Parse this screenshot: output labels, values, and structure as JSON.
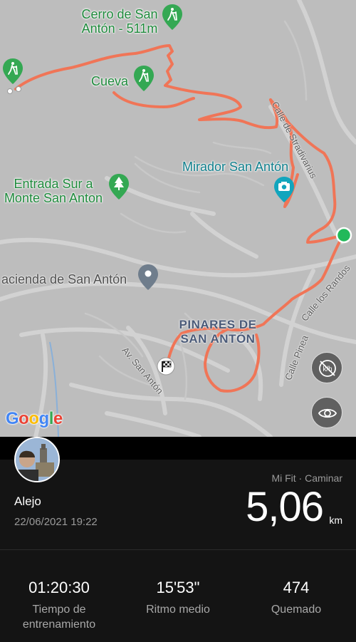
{
  "map": {
    "places": {
      "cerro": "Cerro de San\nAntón - 511m",
      "cueva": "Cueva",
      "mirador": "Mirador San Antón",
      "entrada": "Entrada Sur a\nMonte San Anton",
      "hacienda": "acienda de San Antón",
      "pinares": "PINARES DE\nSAN ANTÓN"
    },
    "streets": {
      "stradivarius": "Calle de Stradivarius",
      "randos": "Calle los Randos",
      "pinea": "Calle Pinea",
      "av_san_anton": "Av. San Antón"
    },
    "attribution": "Google",
    "route_color": "#f07557",
    "buttons": {
      "layers_icon": "km-layer-off-icon",
      "view_icon": "eye-icon"
    }
  },
  "activity": {
    "user_name": "Alejo",
    "datetime": "22/06/2021 19:22",
    "source": "Mi Fit · Caminar",
    "distance": "5,06",
    "distance_unit": "km"
  },
  "stats": [
    {
      "value": "01:20:30",
      "label": "Tiempo de\nentrenamiento"
    },
    {
      "value": "15'53\"",
      "label": "Ritmo medio"
    },
    {
      "value": "474",
      "label": "Quemado"
    }
  ]
}
